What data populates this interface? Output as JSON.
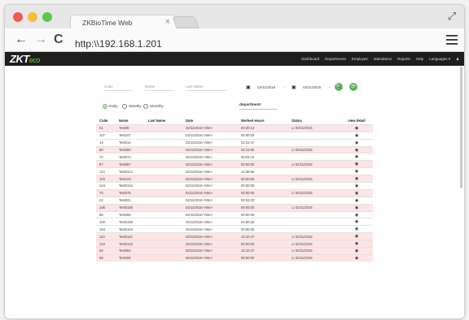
{
  "browser": {
    "tab_title": "ZKBioTime Web",
    "tab_close": "×",
    "url": "http:\\\\192.168.1.201",
    "back": "←",
    "forward": "→",
    "reload": "C",
    "fullscreen": "⤢",
    "traffic_light_colors": [
      "#ee5b52",
      "#f6bc3e",
      "#5cc64d"
    ]
  },
  "app": {
    "logo_main": "ZKT",
    "logo_sub": "eco",
    "nav": [
      "Dashboard",
      "Departments",
      "Employee",
      "attendance",
      "Reports",
      "Help",
      "Languages ▾",
      "♟"
    ]
  },
  "filters": {
    "code_label": "Code",
    "name_label": "Name",
    "lastname_label": "Last Name",
    "date_from": "02/11/2016",
    "date_to": "02/11/2016",
    "sep": "-",
    "calendar_icon": "▣",
    "search_icon": "🔍",
    "reset_icon": "⟳",
    "accent": "#5cb85c"
  },
  "period": {
    "options": [
      "Daily",
      "Weekly",
      "Monthly"
    ],
    "selected": "Daily"
  },
  "department_label": "department",
  "table": {
    "headers": [
      "Code",
      "Name",
      "Last Name",
      "Date",
      "Worked Hours",
      "Status",
      "view detail"
    ],
    "rows": [
      {
        "code": "01",
        "name": "Test06",
        "last": "",
        "date": "02/11/2016 <We>",
        "hours": "00:20:13",
        "status": "☑ 02/11/2016",
        "pink": true
      },
      {
        "code": "107",
        "name": "Test107",
        "last": "",
        "date": "02/11/2016 <We>",
        "hours": "00:00:08",
        "status": "",
        "pink": false
      },
      {
        "code": "14",
        "name": "Test014",
        "last": "",
        "date": "02/11/2016 <We>",
        "hours": "01:24:47",
        "status": "",
        "pink": false
      },
      {
        "code": "80",
        "name": "Test080",
        "last": "",
        "date": "02/11/2016 <We>",
        "hours": "02:13:00",
        "status": "☑ 02/11/2016",
        "pink": true
      },
      {
        "code": "73",
        "name": "Test073",
        "last": "",
        "date": "02/11/2016 <We>",
        "hours": "00:04:22",
        "status": "",
        "pink": false
      },
      {
        "code": "87",
        "name": "Test087",
        "last": "",
        "date": "02/11/2016 <We>",
        "hours": "00:00:00",
        "status": "☑ 02/11/2016",
        "pink": true
      },
      {
        "code": "113",
        "name": "Test0113",
        "last": "",
        "date": "02/11/2016 <We>",
        "hours": "12:48:50",
        "status": "",
        "pink": false
      },
      {
        "code": "103",
        "name": "Test103",
        "last": "",
        "date": "02/11/2016 <We>",
        "hours": "00:00:00",
        "status": "☑ 02/11/2016",
        "pink": true
      },
      {
        "code": "124",
        "name": "Test0124",
        "last": "",
        "date": "02/11/2016 <We>",
        "hours": "00:00:00",
        "status": "",
        "pink": false
      },
      {
        "code": "75",
        "name": "Test075",
        "last": "",
        "date": "02/11/2016 <We>",
        "hours": "00:00:00",
        "status": "☑ 02/11/2016",
        "pink": true
      },
      {
        "code": "21",
        "name": "Test021",
        "last": "",
        "date": "02/11/2016 <We>",
        "hours": "00:04:23",
        "status": "",
        "pink": false
      },
      {
        "code": "106",
        "name": "Test0106",
        "last": "",
        "date": "02/11/2016 <We>",
        "hours": "00:00:00",
        "status": "☑ 02/11/2016",
        "pink": true
      },
      {
        "code": "65",
        "name": "Test065",
        "last": "",
        "date": "02/11/2016 <We>",
        "hours": "00:00:00",
        "status": "",
        "pink": false
      },
      {
        "code": "100",
        "name": "Test0100",
        "last": "",
        "date": "02/11/2016 <We>",
        "hours": "04:00:26",
        "status": "",
        "pink": false
      },
      {
        "code": "104",
        "name": "Test0104",
        "last": "",
        "date": "02/11/2016 <We>",
        "hours": "00:00:00",
        "status": "",
        "pink": false
      },
      {
        "code": "110",
        "name": "Test0110",
        "last": "",
        "date": "02/11/2016 <We>",
        "hours": "10:10:47",
        "status": "☑ 02/11/2016",
        "pink": true
      },
      {
        "code": "123",
        "name": "Test0123",
        "last": "",
        "date": "02/11/2016 <We>",
        "hours": "00:00:00",
        "status": "☑ 02/11/2016",
        "pink": true
      },
      {
        "code": "52",
        "name": "Test052",
        "last": "",
        "date": "02/11/2016 <We>",
        "hours": "10:10:47",
        "status": "☑ 02/11/2016",
        "pink": true
      },
      {
        "code": "66",
        "name": "Test066",
        "last": "",
        "date": "02/11/2016 <We>",
        "hours": "00:00:00",
        "status": "☑ 02/11/2016",
        "pink": true
      }
    ],
    "eye_icon": "◉"
  }
}
